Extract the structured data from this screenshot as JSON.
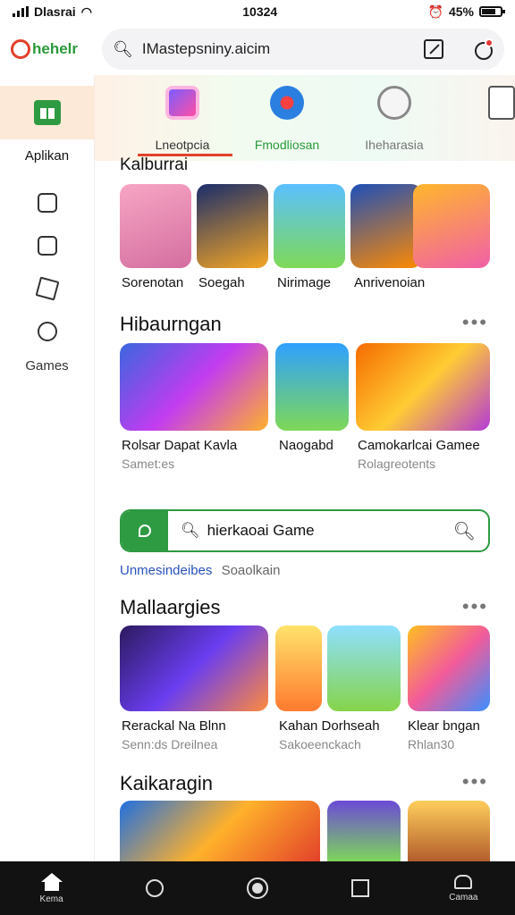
{
  "status": {
    "carrier": "Dlasrai",
    "time": "10324",
    "battery_pct": "45%"
  },
  "top_bar": {
    "logo_text": "hehelr",
    "search_text": "IMastepsniny.aicim"
  },
  "sidebar": {
    "active_label": "Aplikan",
    "games_label": "Games"
  },
  "tabs": [
    {
      "label": "Lneotpcia"
    },
    {
      "label": "Fmodliosan"
    },
    {
      "label": "Iheharasia"
    }
  ],
  "sections": {
    "s1": {
      "title": "Kalburrai",
      "items": [
        {
          "label": "Sorenotan"
        },
        {
          "label": "Soegah"
        },
        {
          "label": "Nirimage"
        },
        {
          "label": "Anrivenoian"
        }
      ]
    },
    "s2": {
      "title": "Hibaurngan",
      "items": [
        {
          "label": "Rolsar Dapat   Kavla",
          "sub": "Samet:es"
        },
        {
          "label": "Naogabd",
          "sub": ""
        },
        {
          "label": "Camokarlcai Gamee",
          "sub": "Rolagreotents"
        }
      ]
    },
    "search_game": {
      "text": "hierkaoai Game"
    },
    "links": {
      "a": "Unmesindeibes",
      "b": "Soaolkain"
    },
    "s3": {
      "title": "Mallaargies",
      "items": [
        {
          "label": "Rerackal Na  Blnn",
          "sub": "Senn:ds   Dreilnea"
        },
        {
          "label": "Kahan  Dorhseah",
          "sub": "Sakoeenckach"
        },
        {
          "label": "Klear bngan",
          "sub": "Rhlan30"
        }
      ]
    },
    "s4": {
      "title": "Kaikaragin"
    }
  },
  "bottom_nav": {
    "home": "Kema",
    "profile": "Camaa"
  },
  "colors": {
    "accent": "#e2402a",
    "green": "#2e9a42",
    "nav_bg": "#121212"
  }
}
